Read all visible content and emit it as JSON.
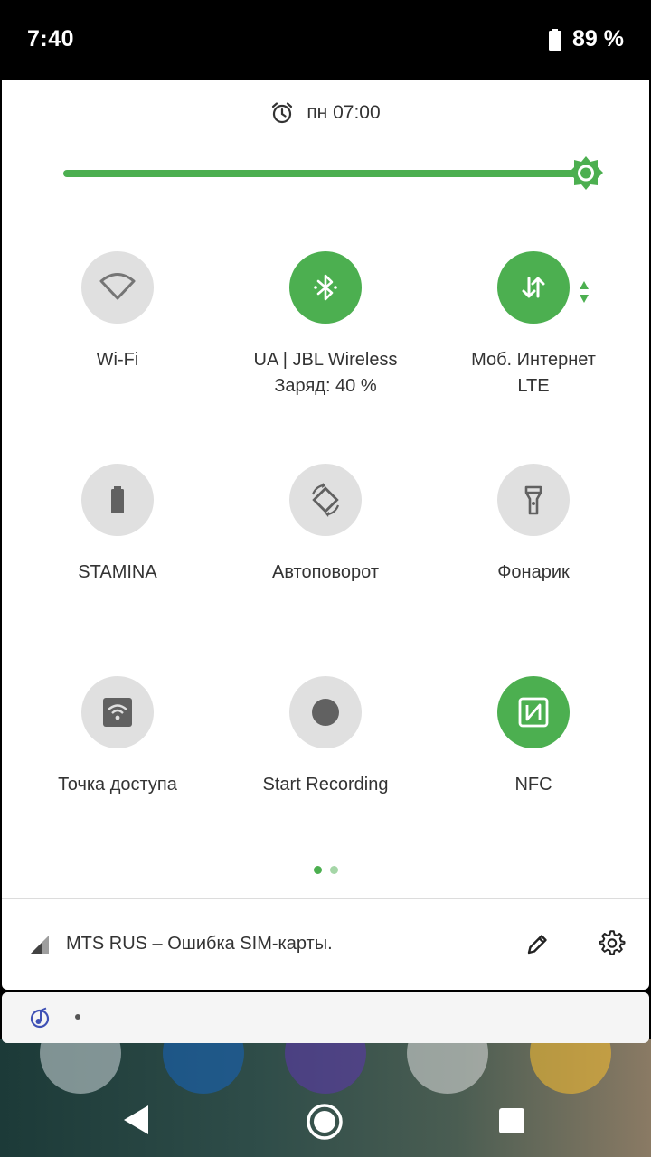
{
  "status_bar": {
    "time": "7:40",
    "battery_percent": "89 %",
    "battery_level": 0.89
  },
  "quick_settings": {
    "alarm_text": "пн 07:00",
    "brightness_level": 1.0,
    "accent_color": "#4caf50",
    "tiles": [
      {
        "label": "Wi-Fi",
        "sublabel": "",
        "state": "off",
        "icon": "wifi-icon"
      },
      {
        "label": "UA | JBL Wireless",
        "sublabel": "Заряд: 40 %",
        "state": "on",
        "icon": "bluetooth-icon"
      },
      {
        "label": "Моб. Интернет",
        "sublabel": "LTE",
        "state": "on",
        "icon": "mobile-data-icon"
      },
      {
        "label": "STAMINA",
        "sublabel": "",
        "state": "off",
        "icon": "battery-icon"
      },
      {
        "label": "Автоповорот",
        "sublabel": "",
        "state": "off",
        "icon": "autorotate-icon"
      },
      {
        "label": "Фонарик",
        "sublabel": "",
        "state": "off",
        "icon": "flashlight-icon"
      },
      {
        "label": "Точка доступа",
        "sublabel": "",
        "state": "off",
        "icon": "hotspot-icon"
      },
      {
        "label": "Start Recording",
        "sublabel": "",
        "state": "off",
        "icon": "record-icon"
      },
      {
        "label": "NFC",
        "sublabel": "",
        "state": "on",
        "icon": "nfc-icon"
      }
    ],
    "pages": 2,
    "current_page": 1
  },
  "footer": {
    "carrier_text": "MTS RUS – Ошибка SIM-карты."
  }
}
